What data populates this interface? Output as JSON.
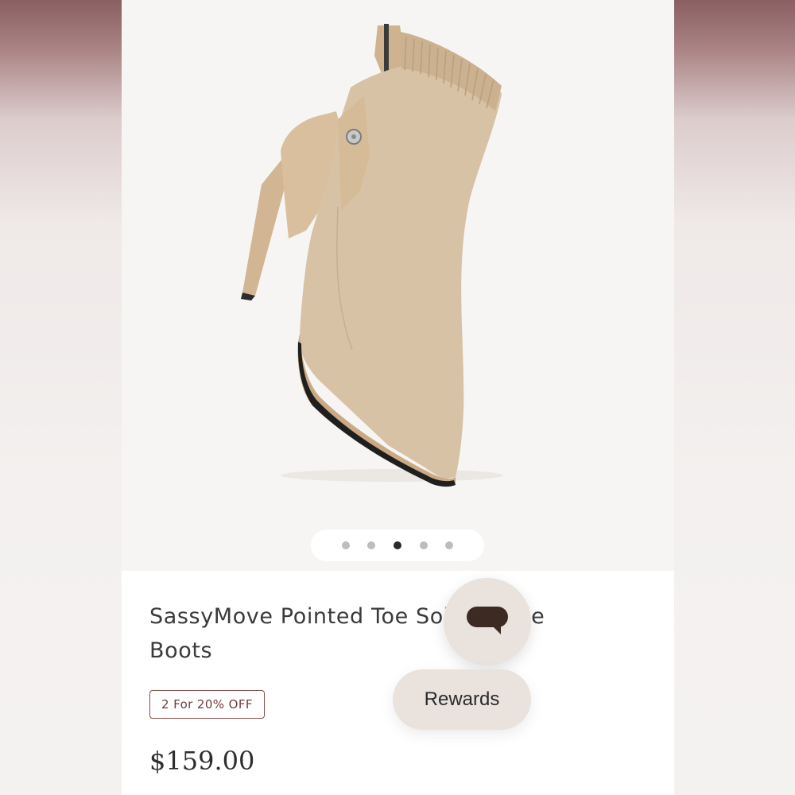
{
  "product": {
    "title": "SassyMove Pointed Toe Soles Ankle\nBoots",
    "promo_badge": "2 For 20% OFF",
    "price": "$159.00",
    "image_alt": "Beige knit pointed toe stiletto ankle boot"
  },
  "gallery": {
    "total_images": 5,
    "active_index": 3
  },
  "floating": {
    "chat_icon": "chat-bubble-icon",
    "rewards_label": "Rewards"
  },
  "colors": {
    "boot_knit": "#d8c2a5",
    "boot_leather": "#d9bf9e",
    "promo_border": "#8a4a4a",
    "button_bg": "#e9e2dd",
    "chat_icon": "#3d2a22"
  }
}
